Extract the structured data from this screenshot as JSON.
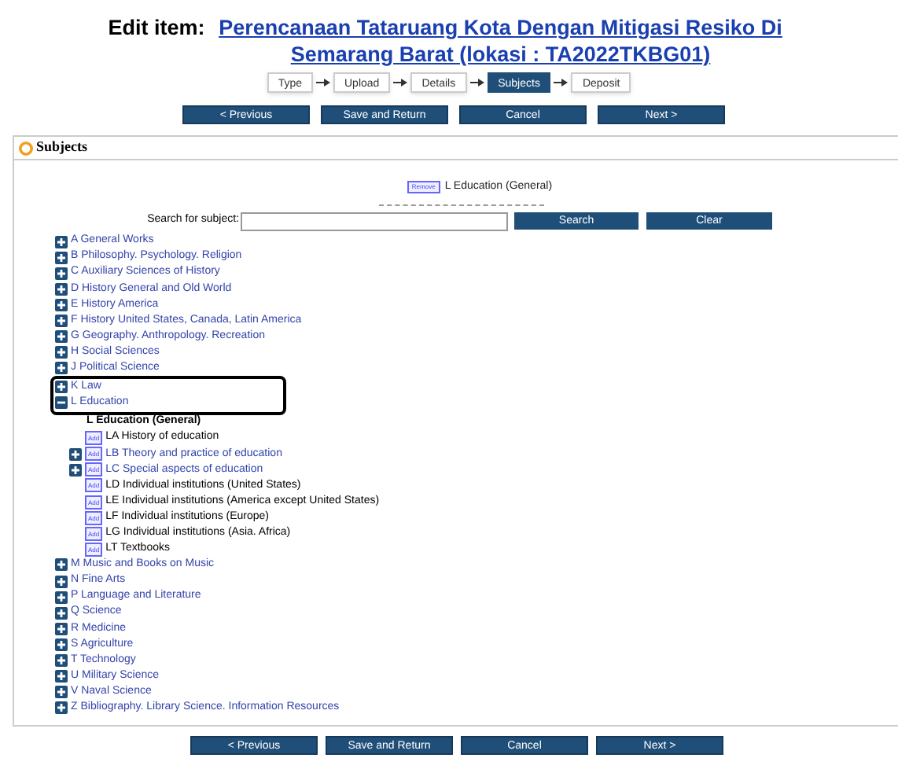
{
  "heading": {
    "prefix": "Edit item:",
    "title": "Perencanaan Tataruang Kota Dengan Mitigasi Resiko Di Semarang Barat (lokasi : TA2022TKBG01)"
  },
  "steps": [
    {
      "label": "Type",
      "selected": false
    },
    {
      "label": "Upload",
      "selected": false
    },
    {
      "label": "Details",
      "selected": false
    },
    {
      "label": "Subjects",
      "selected": true
    },
    {
      "label": "Deposit",
      "selected": false
    }
  ],
  "buttons_top": [
    "< Previous",
    "Save and Return",
    "Cancel",
    "Next >"
  ],
  "buttons_bottom": [
    "< Previous",
    "Save and Return",
    "Cancel",
    "Next >"
  ],
  "panel": {
    "title": "Subjects",
    "selected_subjects": [
      {
        "button": "Remove",
        "label": "L Education (General)"
      }
    ],
    "search": {
      "label": "Search for subject:",
      "search_button": "Search",
      "clear_button": "Clear"
    },
    "tree": [
      {
        "label": "A General Works",
        "kind": "group",
        "expanded": false,
        "highlighted": false
      },
      {
        "label": "B Philosophy. Psychology. Religion",
        "kind": "group",
        "expanded": false,
        "highlighted": false
      },
      {
        "label": "C Auxiliary Sciences of History",
        "kind": "group",
        "expanded": false,
        "highlighted": false
      },
      {
        "label": "D History General and Old World",
        "kind": "group",
        "expanded": false,
        "highlighted": false
      },
      {
        "label": "E History America",
        "kind": "group",
        "expanded": false,
        "highlighted": false
      },
      {
        "label": "F History United States, Canada, Latin America",
        "kind": "group",
        "expanded": false,
        "highlighted": false
      },
      {
        "label": "G Geography. Anthropology. Recreation",
        "kind": "group",
        "expanded": false,
        "highlighted": false
      },
      {
        "label": "H Social Sciences",
        "kind": "group",
        "expanded": false,
        "highlighted": false
      },
      {
        "label": "J Political Science",
        "kind": "group",
        "expanded": false,
        "highlighted": false
      },
      {
        "label": "K Law",
        "kind": "group",
        "expanded": false,
        "highlighted": true
      },
      {
        "label": "L Education",
        "kind": "group",
        "expanded": true,
        "highlighted": true,
        "children": [
          {
            "label": "L Education (General)",
            "kind": "chosen"
          },
          {
            "label": "LA History of education",
            "kind": "leaf",
            "add": "Add"
          },
          {
            "label": "LB Theory and practice of education",
            "kind": "group",
            "expanded": false,
            "add": "Add"
          },
          {
            "label": "LC Special aspects of education",
            "kind": "group",
            "expanded": false,
            "add": "Add"
          },
          {
            "label": "LD Individual institutions (United States)",
            "kind": "leaf",
            "add": "Add"
          },
          {
            "label": "LE Individual institutions (America except United States)",
            "kind": "leaf",
            "add": "Add"
          },
          {
            "label": "LF Individual institutions (Europe)",
            "kind": "leaf",
            "add": "Add"
          },
          {
            "label": "LG Individual institutions (Asia. Africa)",
            "kind": "leaf",
            "add": "Add"
          },
          {
            "label": "LT Textbooks",
            "kind": "leaf",
            "add": "Add"
          }
        ]
      },
      {
        "label": "M Music and Books on Music",
        "kind": "group",
        "expanded": false,
        "highlighted": false
      },
      {
        "label": "N Fine Arts",
        "kind": "group",
        "expanded": false,
        "highlighted": false
      },
      {
        "label": "P Language and Literature",
        "kind": "group",
        "expanded": false,
        "highlighted": false
      },
      {
        "label": "Q Science",
        "kind": "group",
        "expanded": false,
        "highlighted": false
      },
      {
        "label": "R Medicine",
        "kind": "group",
        "expanded": false,
        "highlighted": false
      },
      {
        "label": "S Agriculture",
        "kind": "group",
        "expanded": false,
        "highlighted": false
      },
      {
        "label": "T Technology",
        "kind": "group",
        "expanded": false,
        "highlighted": false
      },
      {
        "label": "U Military Science",
        "kind": "group",
        "expanded": false,
        "highlighted": false
      },
      {
        "label": "V Naval Science",
        "kind": "group",
        "expanded": false,
        "highlighted": false
      },
      {
        "label": "Z Bibliography. Library Science. Information Resources",
        "kind": "group",
        "expanded": false,
        "highlighted": false
      }
    ]
  }
}
